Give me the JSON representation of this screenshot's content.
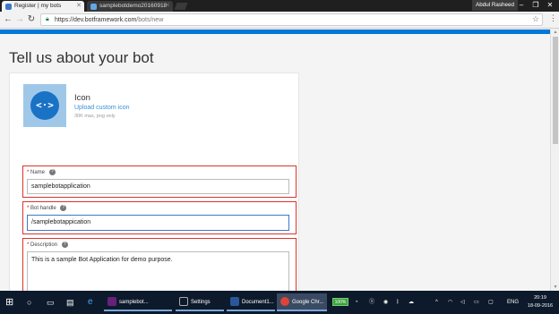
{
  "browser": {
    "tabs": [
      {
        "title": "Register | my bots",
        "active": true
      },
      {
        "title": "samplebotdemo20160918",
        "active": false
      }
    ],
    "user": "Abdul Rasheed",
    "url_host": "https://dev.botframework.com",
    "url_path": "/bots/new"
  },
  "page": {
    "title": "Tell us about your bot",
    "icon_section": {
      "title": "Icon",
      "upload_link": "Upload custom icon",
      "note": "30K max, png only"
    },
    "fields": {
      "name": {
        "label": "Name",
        "value": "samplebotapplication"
      },
      "handle": {
        "label": "Bot handle",
        "value": "/samplebotappication"
      },
      "description": {
        "label": "Description",
        "value": "This is a sample Bot Application for demo purpose."
      }
    },
    "required_marker": "*",
    "help_glyph": "?"
  },
  "taskbar": {
    "apps": [
      {
        "label": "samplebot...",
        "color": "#68217a"
      },
      {
        "label": "Settings",
        "color": "#0d1a2b"
      },
      {
        "label": "Document1...",
        "color": "#2b579a"
      },
      {
        "label": "Google Chr...",
        "color": "#db4437"
      }
    ],
    "battery": "100%",
    "language": "ENG",
    "time": "20:19",
    "date": "18-09-2016"
  },
  "colors": {
    "accent": "#0078d7",
    "error_border": "#d9342b",
    "link": "#3b8ed8",
    "taskbar": "#0d1a2b"
  }
}
